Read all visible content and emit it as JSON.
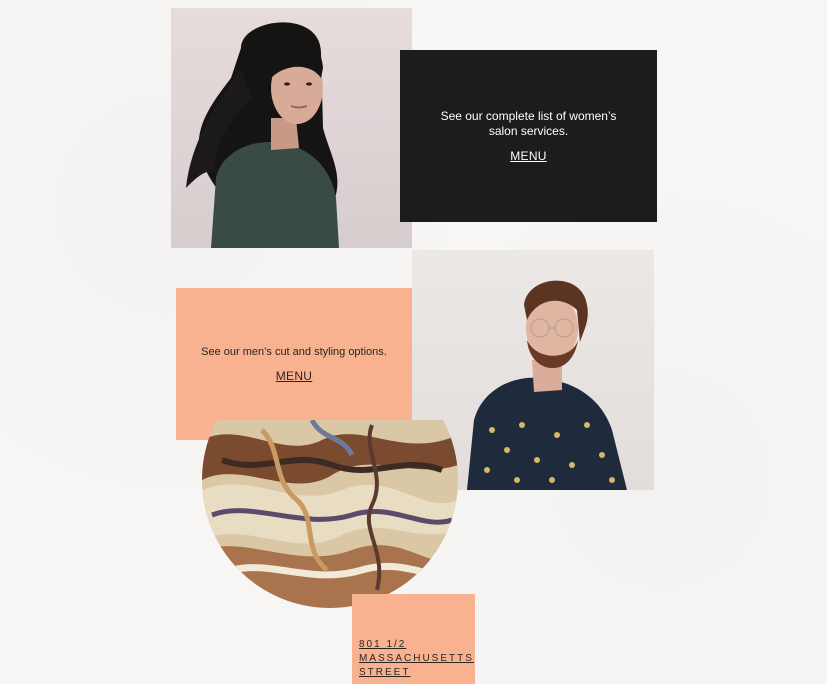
{
  "women_card": {
    "description": "See our complete list of women’s salon services.",
    "menu_label": "MENU"
  },
  "men_card": {
    "description": "See our men’s cut and styling options.",
    "menu_label": "MENU"
  },
  "address": {
    "line1": "801 1/2",
    "line2": "MASSACHUSETTS",
    "line3": "STREET"
  },
  "colors": {
    "dark_card": "#1c1c1c",
    "peach_accent": "#f8b290",
    "background": "#f7f6f4"
  }
}
